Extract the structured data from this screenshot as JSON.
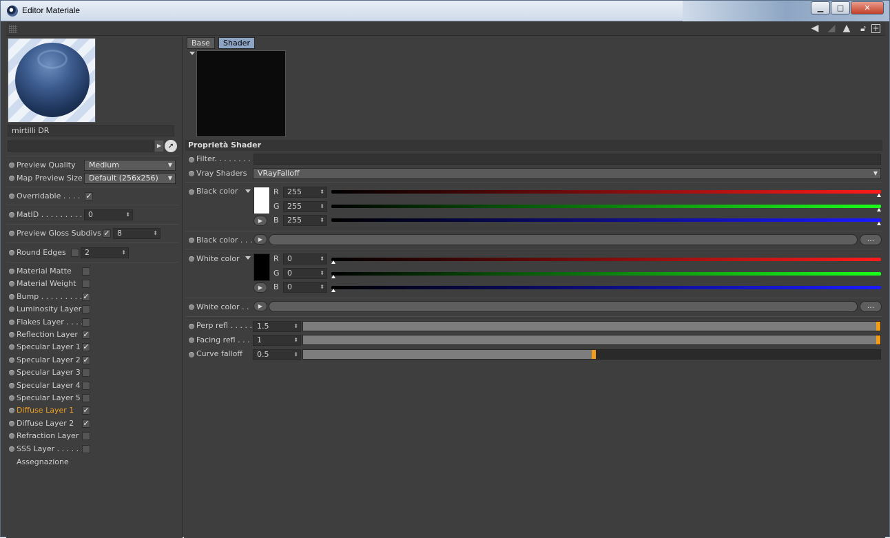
{
  "window": {
    "title": "Editor Materiale"
  },
  "material": {
    "name": "mirtilli DR"
  },
  "left_panel": {
    "preview_quality": {
      "label": "Preview Quality",
      "value": "Medium"
    },
    "map_preview_size": {
      "label": "Map Preview Size",
      "value": "Default (256x256)"
    },
    "overridable": {
      "label": "Overridable . . . .",
      "checked": true
    },
    "matid": {
      "label": "MatID . . . . . . . . .",
      "value": "0"
    },
    "preview_gloss": {
      "label": "Preview Gloss Subdivs",
      "checked": true,
      "value": "8"
    },
    "round_edges": {
      "label": "Round Edges",
      "checked": false,
      "value": "2"
    },
    "layers": [
      {
        "label": "Material Matte",
        "checked": false,
        "active": false
      },
      {
        "label": "Material Weight",
        "checked": false,
        "active": false
      },
      {
        "label": "Bump . . . . . . . . .",
        "checked": true,
        "active": false
      },
      {
        "label": "Luminosity Layer",
        "checked": false,
        "active": false
      },
      {
        "label": "Flakes Layer . . . .",
        "checked": false,
        "active": false
      },
      {
        "label": "Reflection Layer",
        "checked": true,
        "active": false
      },
      {
        "label": "Specular Layer 1",
        "checked": true,
        "active": false
      },
      {
        "label": "Specular Layer 2",
        "checked": true,
        "active": false
      },
      {
        "label": "Specular Layer 3",
        "checked": false,
        "active": false
      },
      {
        "label": "Specular Layer 4",
        "checked": false,
        "active": false
      },
      {
        "label": "Specular Layer 5",
        "checked": false,
        "active": false
      },
      {
        "label": "Diffuse Layer 1",
        "checked": true,
        "active": true
      },
      {
        "label": "Diffuse Layer 2",
        "checked": true,
        "active": false
      },
      {
        "label": "Refraction Layer",
        "checked": false,
        "active": false
      },
      {
        "label": "SSS Layer . . . . . .",
        "checked": false,
        "active": false
      }
    ],
    "assignment": "Assegnazione"
  },
  "tabs": [
    {
      "label": "Base",
      "active": false
    },
    {
      "label": "Shader",
      "active": true
    }
  ],
  "section_title": "Proprietà Shader",
  "filter": {
    "label": "Filter. . . . . . . .",
    "value": ""
  },
  "vray_shaders": {
    "label": "Vray Shaders",
    "value": "VRayFalloff"
  },
  "black_color": {
    "label": "Black color",
    "swatch": "#ffffff",
    "R": "255",
    "G": "255",
    "B": "255",
    "level": 1.0
  },
  "black_color_tex": {
    "label": "Black color . . .",
    "button": "..."
  },
  "white_color": {
    "label": "White color",
    "swatch": "#000000",
    "R": "0",
    "G": "0",
    "B": "0",
    "level": 0.0
  },
  "white_color_tex": {
    "label": "White color . .",
    "button": "..."
  },
  "perp_refl": {
    "label": "Perp refl . . . . .",
    "value": "1.5",
    "fraction": 1.0
  },
  "facing_refl": {
    "label": "Facing refl . . .",
    "value": "1",
    "fraction": 1.0
  },
  "curve_falloff": {
    "label": "Curve falloff",
    "value": "0.5",
    "fraction": 0.5
  },
  "channel_labels": {
    "r": "R",
    "g": "G",
    "b": "B"
  },
  "colors": {
    "accent": "#f29c1a",
    "active_tab": "#8ea4c4",
    "active_layer": "#f0a020"
  }
}
